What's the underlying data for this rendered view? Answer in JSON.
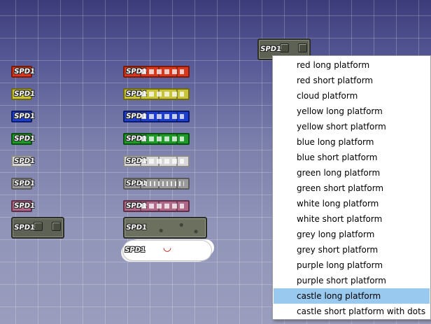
{
  "speed_label": "SPD1",
  "colors": {
    "red": "#d8381e",
    "yellow": "#c8c43a",
    "blue": "#1e3ed0",
    "green": "#1f9a2a",
    "white": "#d8d8d8",
    "grey": "#9a9a9a",
    "purple": "#b06888",
    "menu_highlight": "#99c9ef"
  },
  "context_menu": {
    "items": [
      "red long platform",
      "red short platform",
      "cloud platform",
      "yellow long platform",
      "yellow short platform",
      "blue long platform",
      "blue short platform",
      "green long platform",
      "green short platform",
      "white long platform",
      "white short platform",
      "grey long platform",
      "grey short platform",
      "purple long platform",
      "purple short platform",
      "castle long platform",
      "castle short platform with dots"
    ],
    "selected_index": 15
  }
}
